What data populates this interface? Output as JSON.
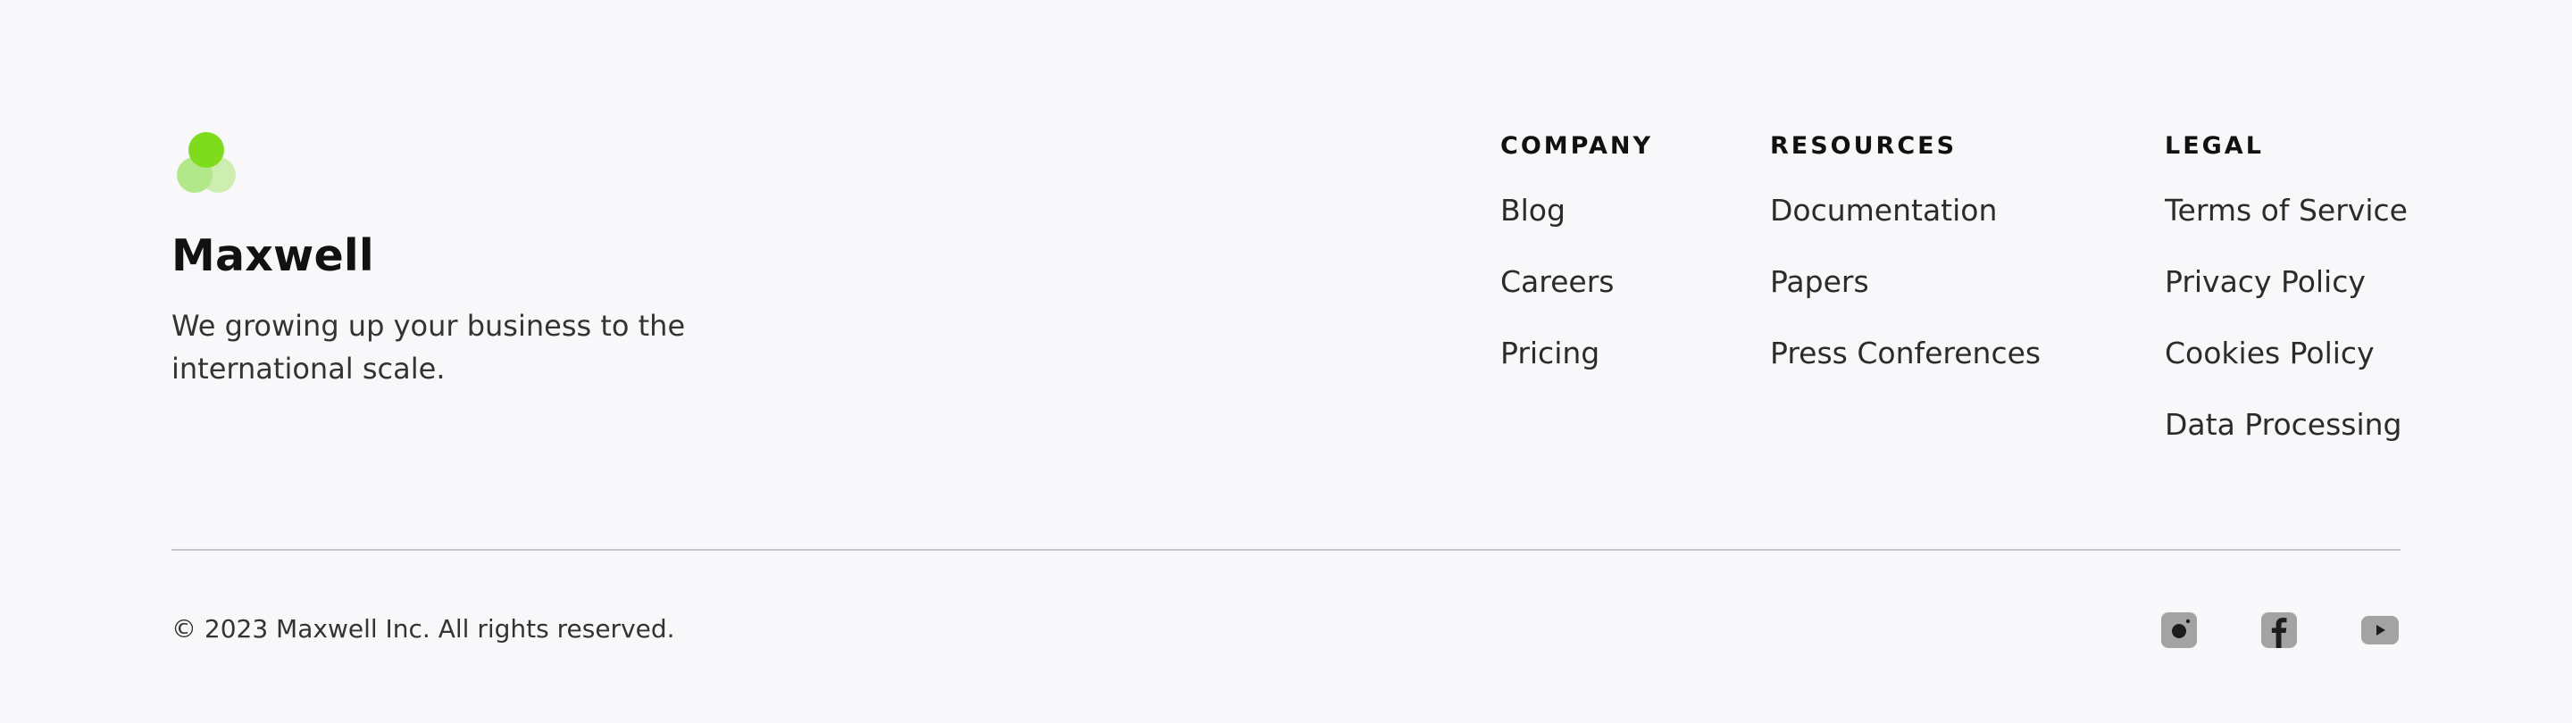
{
  "brand": {
    "name": "Maxwell",
    "tagline": "We growing up your business to the international scale.",
    "logo_icon": "three-circles-logo-icon",
    "colors": {
      "logo_primary": "#7fdc1d",
      "logo_secondary": "#b2e78a",
      "logo_tertiary": "#cdeeb0"
    }
  },
  "columns": {
    "company": {
      "heading": "COMPANY",
      "links": [
        "Blog",
        "Careers",
        "Pricing"
      ]
    },
    "resources": {
      "heading": "RESOURCES",
      "links": [
        "Documentation",
        "Papers",
        "Press Conferences"
      ]
    },
    "legal": {
      "heading": "LEGAL",
      "links": [
        "Terms of Service",
        "Privacy Policy",
        "Cookies Policy",
        "Data Processing"
      ]
    }
  },
  "footer": {
    "copyright": "© 2023 Maxwell Inc. All rights reserved.",
    "social": [
      {
        "icon": "instagram-icon"
      },
      {
        "icon": "facebook-icon"
      },
      {
        "icon": "youtube-icon"
      }
    ],
    "icon_color": "#a3a3a3"
  },
  "colors": {
    "background": "#f8f8fb",
    "text": "#222222",
    "divider": "#c8c8cc"
  }
}
